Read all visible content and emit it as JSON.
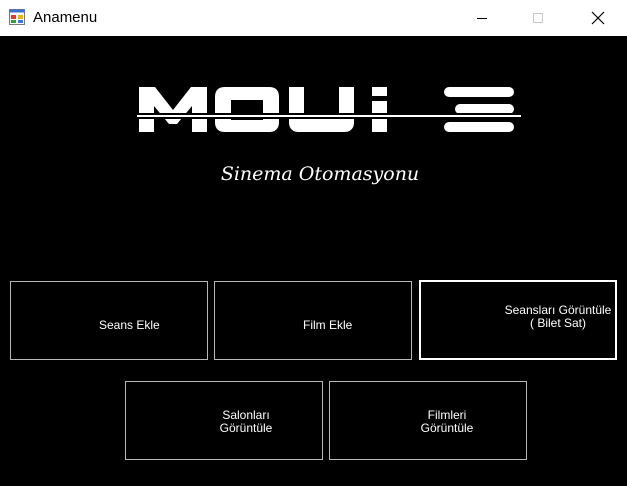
{
  "window": {
    "title": "Anamenu",
    "minimize_glyph": "—",
    "close_glyph": "✕"
  },
  "logo": {
    "text": "MOUi E"
  },
  "subtitle": "Sinema Otomasyonu",
  "buttons": {
    "seans_ekle": "Seans Ekle",
    "film_ekle": "Film Ekle",
    "seanslari_goruntule": "Seansları Görüntüle ( Bilet Sat)",
    "salonlari_goruntule": "Salonları Görüntüle",
    "filmleri_goruntule": "Filmleri Görüntüle"
  },
  "colors": {
    "background": "#000000",
    "titlebar": "#ffffff",
    "button_border": "#b8b8b8",
    "text": "#ffffff"
  }
}
